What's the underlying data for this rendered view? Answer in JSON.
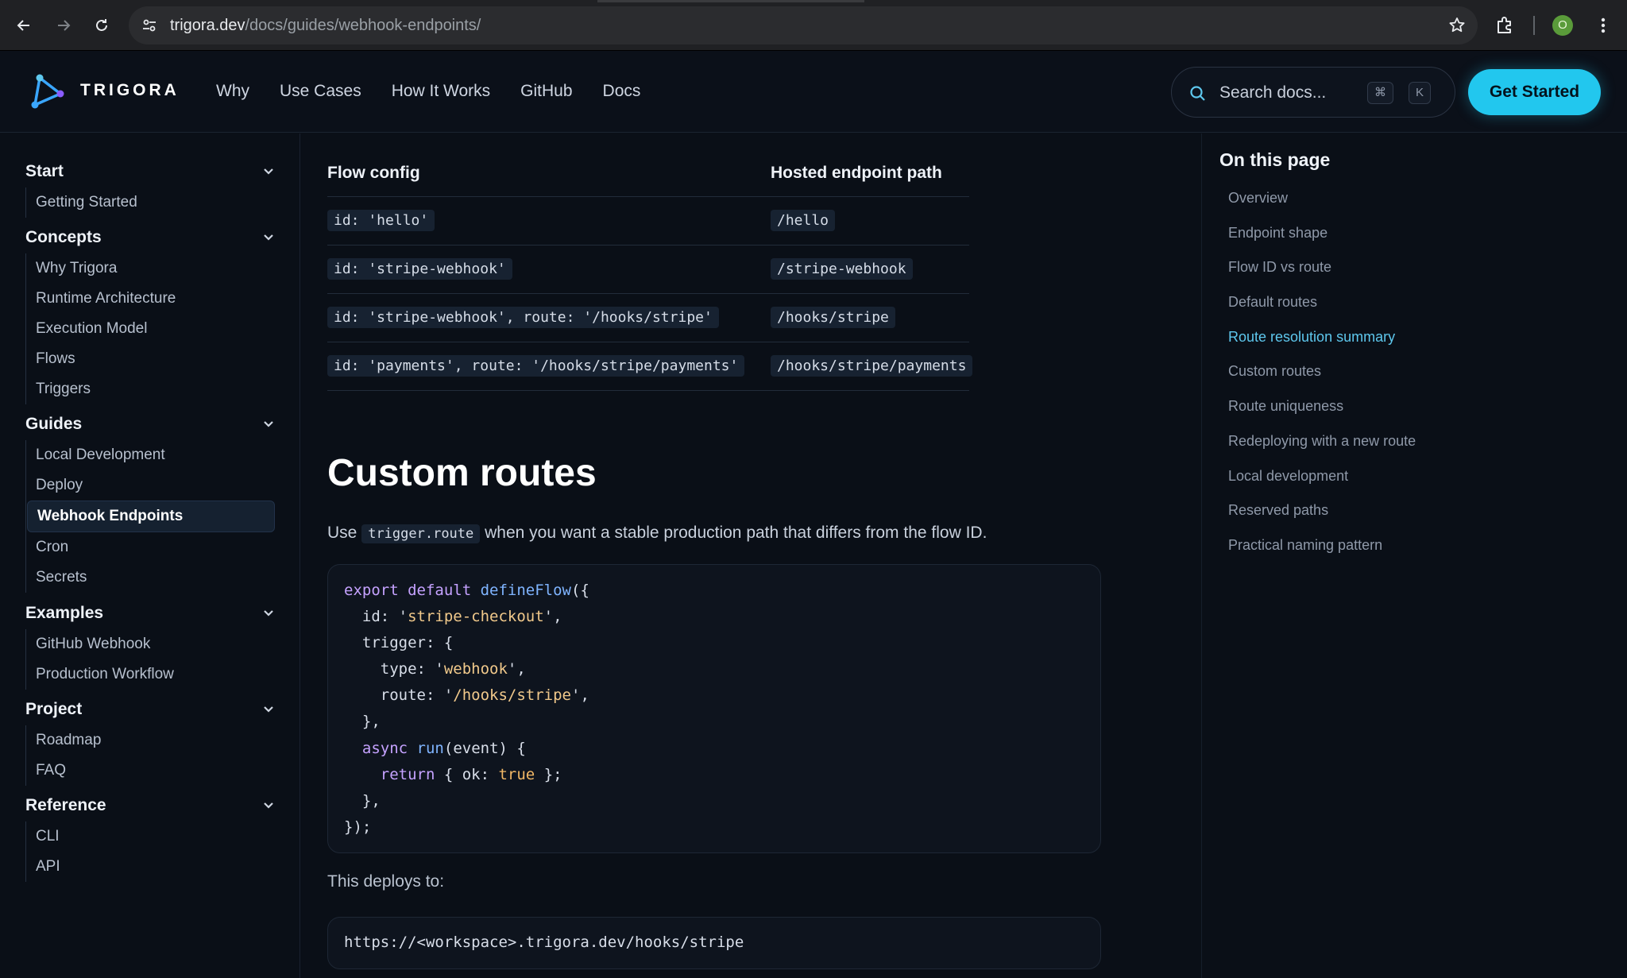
{
  "browser": {
    "url_host": "trigora.dev",
    "url_path": "/docs/guides/webhook-endpoints/",
    "profile_initial": "O"
  },
  "header": {
    "brand": "TRIGORA",
    "nav": [
      "Why",
      "Use Cases",
      "How It Works",
      "GitHub",
      "Docs"
    ],
    "search_placeholder": "Search docs...",
    "search_kbd_1": "⌘",
    "search_kbd_2": "K",
    "cta": "Get Started"
  },
  "sidebar": {
    "groups": [
      {
        "title": "Start",
        "items": [
          "Getting Started"
        ]
      },
      {
        "title": "Concepts",
        "items": [
          "Why Trigora",
          "Runtime Architecture",
          "Execution Model",
          "Flows",
          "Triggers"
        ]
      },
      {
        "title": "Guides",
        "items": [
          "Local Development",
          "Deploy",
          "Webhook Endpoints",
          "Cron",
          "Secrets"
        ]
      },
      {
        "title": "Examples",
        "items": [
          "GitHub Webhook",
          "Production Workflow"
        ]
      },
      {
        "title": "Project",
        "items": [
          "Roadmap",
          "FAQ"
        ]
      },
      {
        "title": "Reference",
        "items": [
          "CLI",
          "API"
        ]
      }
    ],
    "active_item": "Webhook Endpoints"
  },
  "main": {
    "table": {
      "headers": [
        "Flow config",
        "Hosted endpoint path"
      ],
      "rows": [
        [
          "id: 'hello'",
          "/hello"
        ],
        [
          "id: 'stripe-webhook'",
          "/stripe-webhook"
        ],
        [
          "id: 'stripe-webhook', route: '/hooks/stripe'",
          "/hooks/stripe"
        ],
        [
          "id: 'payments', route: '/hooks/stripe/payments'",
          "/hooks/stripe/payments"
        ]
      ]
    },
    "section_title": "Custom routes",
    "para_pre": "Use",
    "para_code": "trigger.route",
    "para_post": "when you want a stable production path that differs from the flow ID.",
    "deploys_text": "This deploys to:",
    "deploy_url": "https://<workspace>.trigora.dev/hooks/stripe"
  },
  "toc": {
    "title": "On this page",
    "items": [
      "Overview",
      "Endpoint shape",
      "Flow ID vs route",
      "Default routes",
      "Route resolution summary",
      "Custom routes",
      "Route uniqueness",
      "Redeploying with a new route",
      "Local development",
      "Reserved paths",
      "Practical naming pattern"
    ],
    "active": "Route resolution summary"
  },
  "colors": {
    "accent": "#22c7ee",
    "toc_active": "#5ec8ee",
    "background": "#0a0f17"
  }
}
